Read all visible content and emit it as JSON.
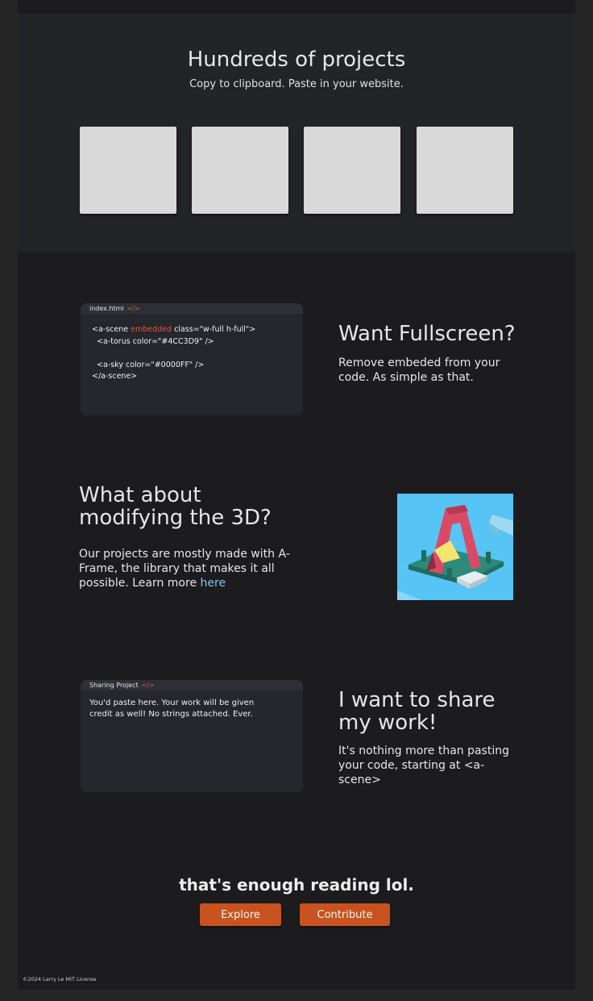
{
  "hero": {
    "title": "Hundreds of projects",
    "subtitle": "Copy to clipboard. Paste in your website."
  },
  "fullscreen": {
    "file_name": "index.html",
    "code_tag": "</>",
    "code": {
      "line1_pre": "<a-scene ",
      "line1_kw": "embedded",
      "line1_post": " class=\"w-full h-full\">",
      "line2": "  <a-torus color=\"#4CC3D9\" />",
      "line3": "",
      "line4": "  <a-sky color=\"#0000FF\" />",
      "line5": "</a-scene>"
    },
    "title": "Want Fullscreen?",
    "body": "Remove embeded from your code. As simple as that."
  },
  "modify": {
    "title": "What about modifying the 3D?",
    "body": "Our projects are mostly made with A-Frame, the library that makes it all possible. Learn more ",
    "link": "here"
  },
  "share": {
    "box_title": "Sharing Project",
    "code_tag": "</>",
    "placeholder": "You'd paste here. Your work will be given credit as well! No strings attached. Ever.",
    "title": "I want to share my work!",
    "body": "It's nothing more than pasting your code, starting at <a-scene>"
  },
  "cta": {
    "title": "that's enough reading lol.",
    "explore": "Explore",
    "contribute": "Contribute"
  },
  "footer": {
    "text": "©2024 Larry Le MIT License"
  },
  "colors": {
    "accent": "#c8531e",
    "link": "#7fc7ef",
    "code_keyword": "#e2533b",
    "illustration_bg": "#56c4f5"
  }
}
